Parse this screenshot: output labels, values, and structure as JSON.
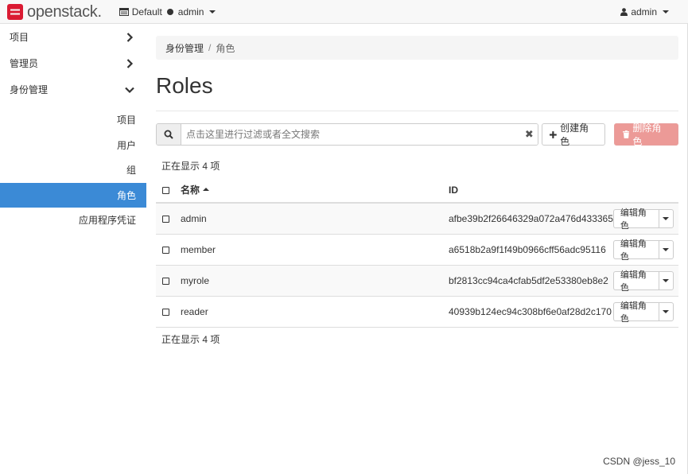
{
  "navbar": {
    "brand": "openstack",
    "brand_dot": ".",
    "domain": "Default",
    "project": "admin",
    "user": "admin"
  },
  "sidebar": {
    "items": [
      {
        "label": "项目",
        "expanded": false
      },
      {
        "label": "管理员",
        "expanded": false
      },
      {
        "label": "身份管理",
        "expanded": true
      }
    ],
    "sub_items": [
      {
        "label": "项目",
        "active": false
      },
      {
        "label": "用户",
        "active": false
      },
      {
        "label": "组",
        "active": false
      },
      {
        "label": "角色",
        "active": true
      },
      {
        "label": "应用程序凭证",
        "active": false
      }
    ]
  },
  "breadcrumb": {
    "parent": "身份管理",
    "separator": "/",
    "current": "角色"
  },
  "page_title": "Roles",
  "toolbar": {
    "search_placeholder": "点击这里进行过滤或者全文搜索",
    "clear_label": "✖",
    "create_label": "创建角色",
    "delete_label": "删除角色"
  },
  "table": {
    "count_text": "正在显示 4 项",
    "columns": {
      "name": "名称",
      "id": "ID"
    },
    "action_label": "编辑角色",
    "rows": [
      {
        "name": "admin",
        "id": "afbe39b2f26646329a072a476d433365"
      },
      {
        "name": "member",
        "id": "a6518b2a9f1f49b0966cff56adc95116"
      },
      {
        "name": "myrole",
        "id": "bf2813cc94ca4cfab5df2e53380eb8e2"
      },
      {
        "name": "reader",
        "id": "40939b124ec94c308bf6e0af28d2c170"
      }
    ]
  },
  "watermark": "CSDN @jess_10",
  "colors": {
    "active_nav": "#3b8ad6",
    "delete_button": "#ec9a97",
    "logo_red": "#da1a32"
  },
  "icons": {
    "logo": "openstack-logo-icon",
    "project_selector": "server-icon",
    "user": "user-icon",
    "search": "search-icon",
    "create": "plus-icon",
    "delete": "trash-icon"
  }
}
